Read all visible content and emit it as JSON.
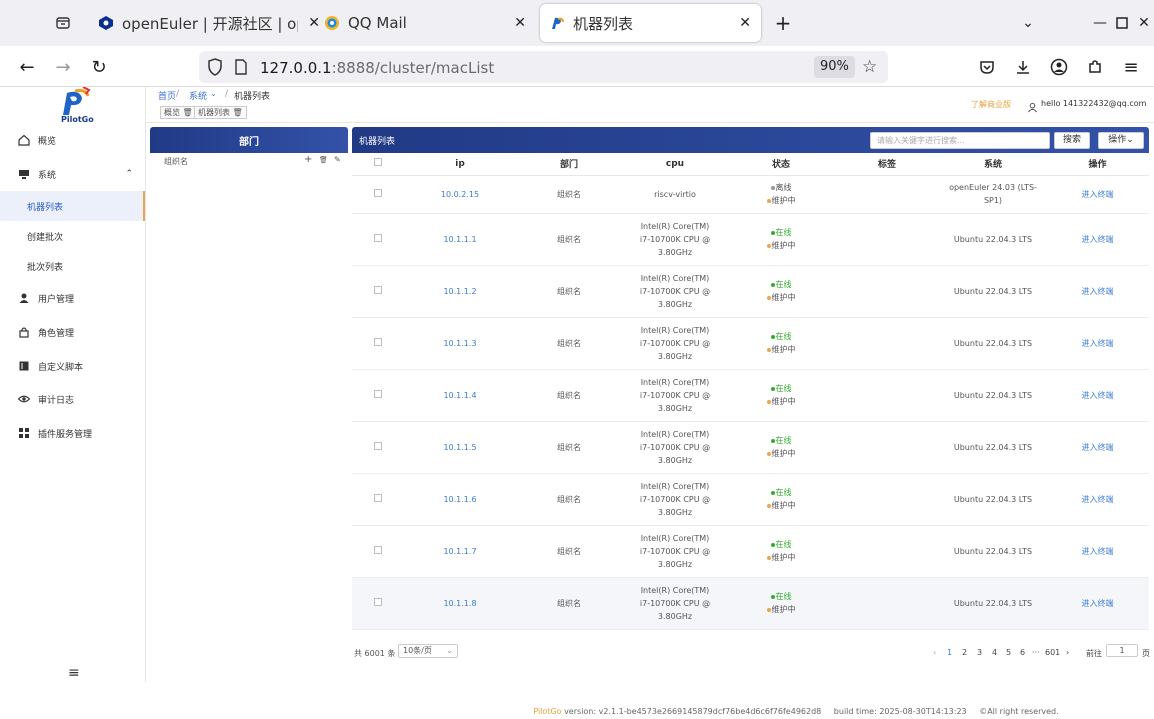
{
  "browser": {
    "tabs": [
      {
        "title": "openEuler | 开源社区 | ope",
        "icon": "openeuler-icon"
      },
      {
        "title": "QQ Mail",
        "icon": "qqmail-icon"
      },
      {
        "title": "机器列表",
        "icon": "pilotgo-icon",
        "active": true
      }
    ],
    "url_host": "127.0.0.1",
    "url_rest": ":8888/cluster/macList",
    "zoom": "90%"
  },
  "app": {
    "logo_text": "PilotGo",
    "sidebar": {
      "items": [
        {
          "label": "概览",
          "icon": "home-icon"
        },
        {
          "label": "系统",
          "icon": "monitor-icon"
        },
        {
          "label": "用户管理",
          "icon": "user-icon"
        },
        {
          "label": "角色管理",
          "icon": "lock-icon"
        },
        {
          "label": "自定义脚本",
          "icon": "script-icon"
        },
        {
          "label": "审计日志",
          "icon": "eye-icon"
        },
        {
          "label": "插件服务管理",
          "icon": "grid-icon"
        }
      ],
      "system_sub": [
        "机器列表",
        "创建批次",
        "批次列表"
      ],
      "menu_toggle": "≡"
    },
    "breadcrumb": [
      "首页",
      "系统",
      "机器列表"
    ],
    "tags": [
      "概览",
      "机器列表"
    ],
    "header_right": {
      "link": "了解商业版",
      "user": "hello 141322432@qq.com"
    },
    "dept_panel": {
      "title": "部门",
      "node": "组织名"
    },
    "mach_panel": {
      "title": "机器列表",
      "search_placeholder": "请输入关键字进行搜索...",
      "search_button": "搜索",
      "ops_button": "操作"
    },
    "table": {
      "columns": [
        "ip",
        "部门",
        "cpu",
        "状态",
        "标签",
        "系统",
        "操作"
      ],
      "rows": [
        {
          "ip": "10.0.2.15",
          "dept": "组织名",
          "cpu": [
            "riscv-virtio"
          ],
          "status": [
            "离线",
            "维护中"
          ],
          "os": [
            "openEuler 24.03 (LTS-",
            "SP1)"
          ],
          "op": "进入终端"
        },
        {
          "ip": "10.1.1.1",
          "dept": "组织名",
          "cpu": [
            "Intel(R) Core(TM)",
            "i7-10700K CPU @",
            "3.80GHz"
          ],
          "status": [
            "在线",
            "维护中"
          ],
          "os": [
            "Ubuntu 22.04.3 LTS"
          ],
          "op": "进入终端"
        },
        {
          "ip": "10.1.1.2",
          "dept": "组织名",
          "cpu": [
            "Intel(R) Core(TM)",
            "i7-10700K CPU @",
            "3.80GHz"
          ],
          "status": [
            "在线",
            "维护中"
          ],
          "os": [
            "Ubuntu 22.04.3 LTS"
          ],
          "op": "进入终端"
        },
        {
          "ip": "10.1.1.3",
          "dept": "组织名",
          "cpu": [
            "Intel(R) Core(TM)",
            "i7-10700K CPU @",
            "3.80GHz"
          ],
          "status": [
            "在线",
            "维护中"
          ],
          "os": [
            "Ubuntu 22.04.3 LTS"
          ],
          "op": "进入终端"
        },
        {
          "ip": "10.1.1.4",
          "dept": "组织名",
          "cpu": [
            "Intel(R) Core(TM)",
            "i7-10700K CPU @",
            "3.80GHz"
          ],
          "status": [
            "在线",
            "维护中"
          ],
          "os": [
            "Ubuntu 22.04.3 LTS"
          ],
          "op": "进入终端"
        },
        {
          "ip": "10.1.1.5",
          "dept": "组织名",
          "cpu": [
            "Intel(R) Core(TM)",
            "i7-10700K CPU @",
            "3.80GHz"
          ],
          "status": [
            "在线",
            "维护中"
          ],
          "os": [
            "Ubuntu 22.04.3 LTS"
          ],
          "op": "进入终端"
        },
        {
          "ip": "10.1.1.6",
          "dept": "组织名",
          "cpu": [
            "Intel(R) Core(TM)",
            "i7-10700K CPU @",
            "3.80GHz"
          ],
          "status": [
            "在线",
            "维护中"
          ],
          "os": [
            "Ubuntu 22.04.3 LTS"
          ],
          "op": "进入终端"
        },
        {
          "ip": "10.1.1.7",
          "dept": "组织名",
          "cpu": [
            "Intel(R) Core(TM)",
            "i7-10700K CPU @",
            "3.80GHz"
          ],
          "status": [
            "在线",
            "维护中"
          ],
          "os": [
            "Ubuntu 22.04.3 LTS"
          ],
          "op": "进入终端"
        },
        {
          "ip": "10.1.1.8",
          "dept": "组织名",
          "cpu": [
            "Intel(R) Core(TM)",
            "i7-10700K CPU @",
            "3.80GHz"
          ],
          "status": [
            "在线",
            "维护中"
          ],
          "os": [
            "Ubuntu 22.04.3 LTS"
          ],
          "op": "进入终端"
        }
      ]
    },
    "pager": {
      "total": "共 6001 条",
      "page_size": "10条/页",
      "pages": [
        "1",
        "2",
        "3",
        "4",
        "5",
        "6",
        "···",
        "601"
      ],
      "current": "1",
      "goto_label": "前往",
      "goto_value": "1",
      "goto_suffix": "页"
    },
    "footer": {
      "brand": "PilotGo",
      "version": " version: v2.1.1-be4573e2669145879dcf76be4d6c6f76fe4962d8",
      "build": "build time: 2025-08-30T14:13:23",
      "rights": "©All right reserved."
    },
    "colors": {
      "primary": "#2b4596",
      "link": "#3a7bd5",
      "online": "#2fae2f",
      "offline": "#999999",
      "maintenance": "#e8a550"
    }
  }
}
